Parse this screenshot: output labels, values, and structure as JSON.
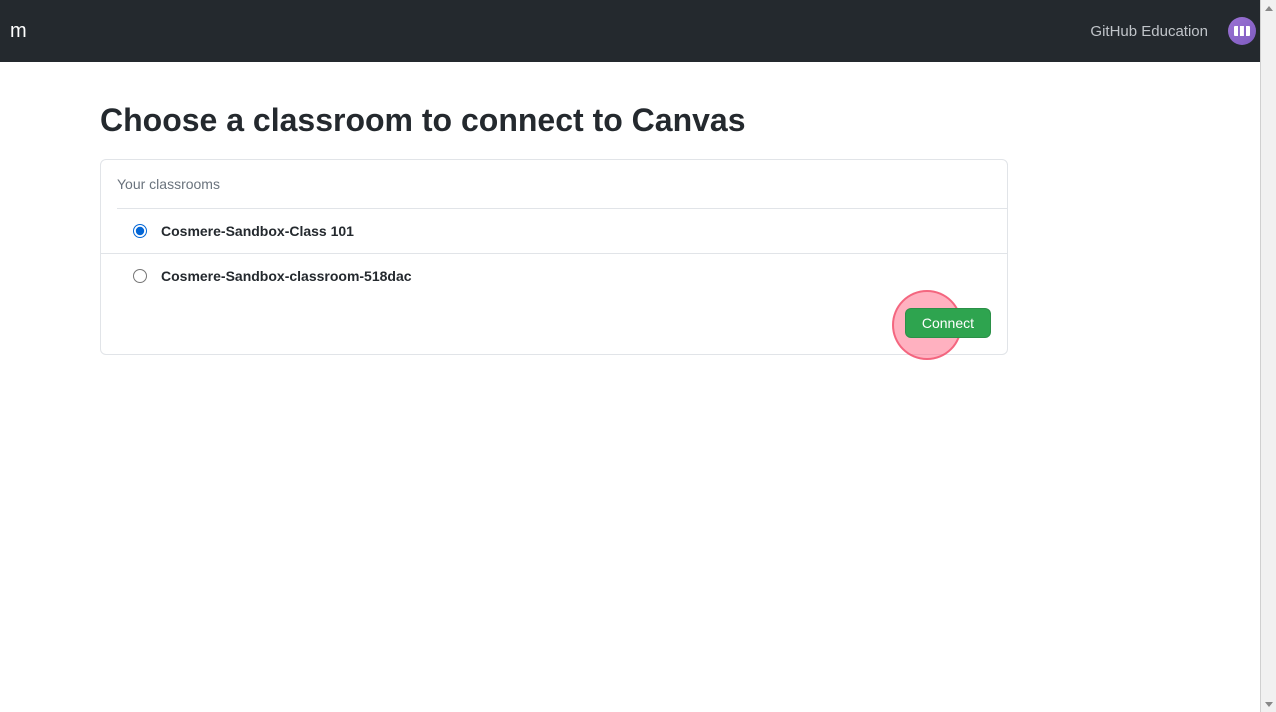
{
  "header": {
    "logo_text": "m",
    "education_link": "GitHub Education"
  },
  "main": {
    "title": "Choose a classroom to connect to Canvas",
    "box_header": "Your classrooms",
    "classrooms": [
      {
        "name": "Cosmere-Sandbox-Class 101",
        "selected": true
      },
      {
        "name": "Cosmere-Sandbox-classroom-518dac",
        "selected": false
      }
    ],
    "connect_button": "Connect"
  }
}
